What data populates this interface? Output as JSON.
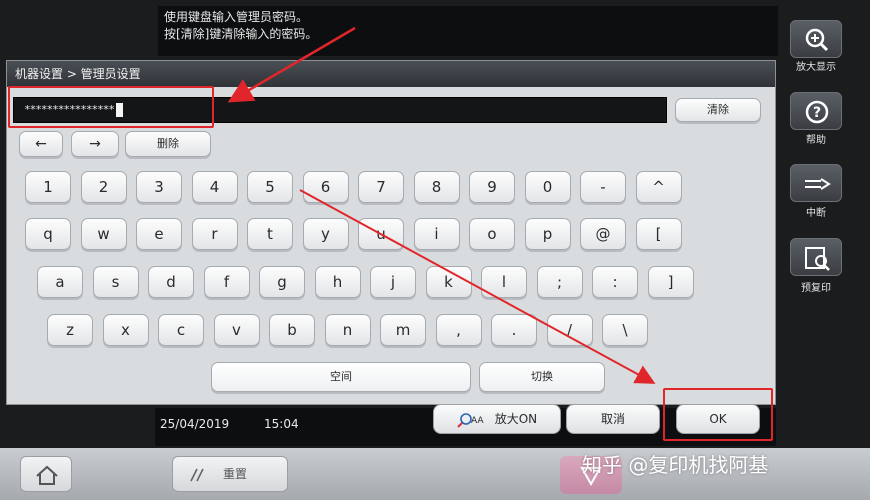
{
  "instructions": {
    "line1": "使用键盘输入管理员密码。",
    "line2": "按[清除]键清除输入的密码。"
  },
  "dialog": {
    "breadcrumb": "机器设置 > 管理员设置",
    "password_mask": "****************",
    "clear_label": "清除",
    "delete_label": "删除",
    "left_arrow": "←",
    "right_arrow": "→"
  },
  "keyboard": {
    "row1": [
      "1",
      "2",
      "3",
      "4",
      "5",
      "6",
      "7",
      "8",
      "9",
      "0",
      "-",
      "^"
    ],
    "row2": [
      "q",
      "w",
      "e",
      "r",
      "t",
      "y",
      "u",
      "i",
      "o",
      "p",
      "@",
      "["
    ],
    "row3": [
      "a",
      "s",
      "d",
      "f",
      "g",
      "h",
      "j",
      "k",
      "l",
      ";",
      ":",
      "]"
    ],
    "row4": [
      "z",
      "x",
      "c",
      "v",
      "b",
      "n",
      "m",
      ",",
      ".",
      "/",
      "\\"
    ],
    "space_label": "空间",
    "switch_label": "切换"
  },
  "status": {
    "date": "25/04/2019",
    "time": "15:04"
  },
  "actions": {
    "zoom_on": "放大ON",
    "cancel": "取消",
    "ok": "OK"
  },
  "sidebar": {
    "zoom_display": "放大显示",
    "help": "帮助",
    "interrupt": "中断",
    "preview": "预复印"
  },
  "footer": {
    "reset": "重置"
  },
  "watermark": "知乎 @复印机找阿基",
  "colors": {
    "annotation_red": "#e0262a"
  }
}
